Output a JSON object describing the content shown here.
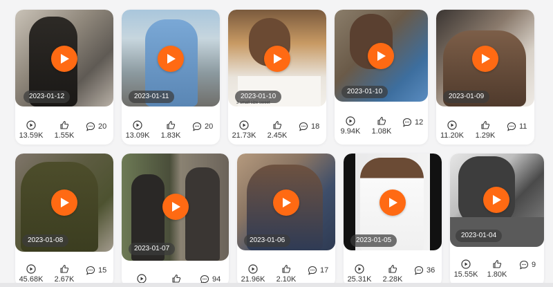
{
  "accent_color": "#ff6a13",
  "cards": [
    {
      "date": "2023-01-12",
      "views": "13.59K",
      "likes": "1.55K",
      "comments": "20"
    },
    {
      "date": "2023-01-11",
      "views": "13.09K",
      "likes": "1.83K",
      "comments": "20"
    },
    {
      "date": "2023-01-10",
      "views": "21.73K",
      "likes": "2.45K",
      "comments": "18"
    },
    {
      "date": "2023-01-10",
      "views": "9.94K",
      "likes": "1.08K",
      "comments": "12"
    },
    {
      "date": "2023-01-09",
      "views": "11.20K",
      "likes": "1.29K",
      "comments": "11"
    },
    {
      "date": "2023-01-08",
      "views": "45.68K",
      "likes": "2.67K",
      "comments": "15"
    },
    {
      "date": "2023-01-07",
      "views": "",
      "likes": "",
      "comments": "94"
    },
    {
      "date": "2023-01-06",
      "views": "21.96K",
      "likes": "2.10K",
      "comments": "17"
    },
    {
      "date": "2023-01-05",
      "views": "25.31K",
      "likes": "2.28K",
      "comments": "36"
    },
    {
      "date": "2023-01-04",
      "views": "15.55K",
      "likes": "1.80K",
      "comments": "9"
    }
  ],
  "thumbnail_overlay_text": {
    "card3": "3 small size sweet"
  }
}
